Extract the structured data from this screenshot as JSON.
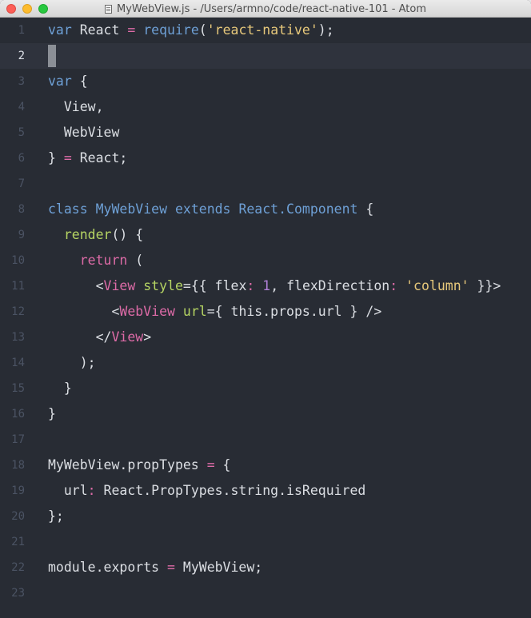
{
  "window": {
    "title": "MyWebView.js - /Users/armno/code/react-native-101 - Atom"
  },
  "editor": {
    "active_line": 2,
    "lines": [
      {
        "num": "1",
        "tokens": [
          {
            "t": "kw",
            "v": "var"
          },
          {
            "t": "plain",
            "v": " React "
          },
          {
            "t": "op",
            "v": "="
          },
          {
            "t": "plain",
            "v": " "
          },
          {
            "t": "kw",
            "v": "require"
          },
          {
            "t": "plain",
            "v": "("
          },
          {
            "t": "str",
            "v": "'react-native'"
          },
          {
            "t": "plain",
            "v": ");"
          }
        ]
      },
      {
        "num": "2",
        "tokens": []
      },
      {
        "num": "3",
        "tokens": [
          {
            "t": "kw",
            "v": "var"
          },
          {
            "t": "plain",
            "v": " {"
          }
        ]
      },
      {
        "num": "4",
        "tokens": [
          {
            "t": "plain",
            "v": "  View,"
          }
        ]
      },
      {
        "num": "5",
        "tokens": [
          {
            "t": "plain",
            "v": "  WebView"
          }
        ]
      },
      {
        "num": "6",
        "tokens": [
          {
            "t": "plain",
            "v": "} "
          },
          {
            "t": "op",
            "v": "="
          },
          {
            "t": "plain",
            "v": " React;"
          }
        ]
      },
      {
        "num": "7",
        "tokens": []
      },
      {
        "num": "8",
        "tokens": [
          {
            "t": "kw",
            "v": "class"
          },
          {
            "t": "plain",
            "v": " "
          },
          {
            "t": "cls",
            "v": "MyWebView"
          },
          {
            "t": "plain",
            "v": " "
          },
          {
            "t": "kw",
            "v": "extends"
          },
          {
            "t": "plain",
            "v": " "
          },
          {
            "t": "cls",
            "v": "React.Component"
          },
          {
            "t": "plain",
            "v": " {"
          }
        ]
      },
      {
        "num": "9",
        "tokens": [
          {
            "t": "plain",
            "v": "  "
          },
          {
            "t": "fn",
            "v": "render"
          },
          {
            "t": "plain",
            "v": "() {"
          }
        ]
      },
      {
        "num": "10",
        "tokens": [
          {
            "t": "plain",
            "v": "    "
          },
          {
            "t": "op",
            "v": "return"
          },
          {
            "t": "plain",
            "v": " ("
          }
        ]
      },
      {
        "num": "11",
        "tokens": [
          {
            "t": "plain",
            "v": "      <"
          },
          {
            "t": "tag",
            "v": "View"
          },
          {
            "t": "plain",
            "v": " "
          },
          {
            "t": "attr",
            "v": "style"
          },
          {
            "t": "plain",
            "v": "={{ flex"
          },
          {
            "t": "op",
            "v": ":"
          },
          {
            "t": "plain",
            "v": " "
          },
          {
            "t": "num",
            "v": "1"
          },
          {
            "t": "plain",
            "v": ", flexDirection"
          },
          {
            "t": "op",
            "v": ":"
          },
          {
            "t": "plain",
            "v": " "
          },
          {
            "t": "str",
            "v": "'column'"
          },
          {
            "t": "plain",
            "v": " }}>"
          }
        ]
      },
      {
        "num": "12",
        "tokens": [
          {
            "t": "plain",
            "v": "        <"
          },
          {
            "t": "tag",
            "v": "WebView"
          },
          {
            "t": "plain",
            "v": " "
          },
          {
            "t": "attr",
            "v": "url"
          },
          {
            "t": "plain",
            "v": "={ this.props.url } />"
          }
        ]
      },
      {
        "num": "13",
        "tokens": [
          {
            "t": "plain",
            "v": "      </"
          },
          {
            "t": "tag",
            "v": "View"
          },
          {
            "t": "plain",
            "v": ">"
          }
        ]
      },
      {
        "num": "14",
        "tokens": [
          {
            "t": "plain",
            "v": "    );"
          }
        ]
      },
      {
        "num": "15",
        "tokens": [
          {
            "t": "plain",
            "v": "  }"
          }
        ]
      },
      {
        "num": "16",
        "tokens": [
          {
            "t": "plain",
            "v": "}"
          }
        ]
      },
      {
        "num": "17",
        "tokens": []
      },
      {
        "num": "18",
        "tokens": [
          {
            "t": "plain",
            "v": "MyWebView.propTypes "
          },
          {
            "t": "op",
            "v": "="
          },
          {
            "t": "plain",
            "v": " {"
          }
        ]
      },
      {
        "num": "19",
        "tokens": [
          {
            "t": "plain",
            "v": "  url"
          },
          {
            "t": "op",
            "v": ":"
          },
          {
            "t": "plain",
            "v": " React.PropTypes.string.isRequired"
          }
        ]
      },
      {
        "num": "20",
        "tokens": [
          {
            "t": "plain",
            "v": "};"
          }
        ]
      },
      {
        "num": "21",
        "tokens": []
      },
      {
        "num": "22",
        "tokens": [
          {
            "t": "plain",
            "v": "module.exports "
          },
          {
            "t": "op",
            "v": "="
          },
          {
            "t": "plain",
            "v": " MyWebView;"
          }
        ]
      },
      {
        "num": "23",
        "tokens": []
      }
    ]
  }
}
